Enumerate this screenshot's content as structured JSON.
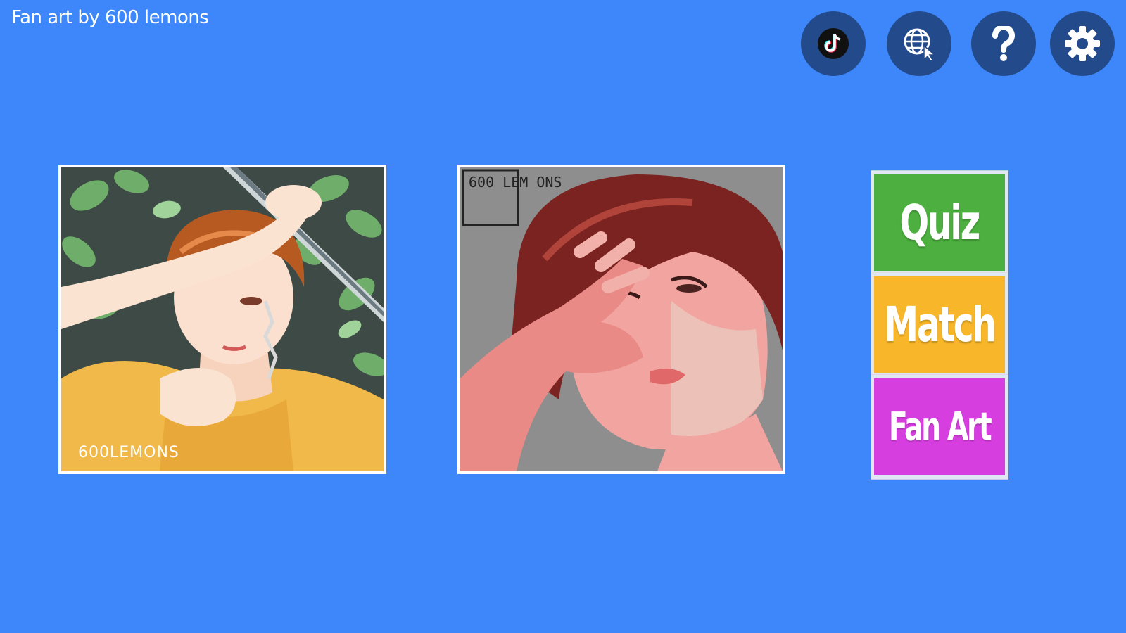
{
  "header": {
    "credit": "Fan art by 600 lemons"
  },
  "toolbar": {
    "buttons": [
      {
        "name": "tiktok-button",
        "icon": "tiktok-icon"
      },
      {
        "name": "website-button",
        "icon": "globe-cursor-icon"
      },
      {
        "name": "help-button",
        "icon": "question-icon"
      },
      {
        "name": "settings-button",
        "icon": "gear-icon"
      }
    ]
  },
  "gallery": {
    "art1": {
      "watermark": "600LEMONS"
    },
    "art2": {
      "watermark": "600 LEM ONS"
    }
  },
  "menu": {
    "quiz_label": "Quiz",
    "match_label": "Match",
    "fanart_label": "Fan Art"
  },
  "colors": {
    "background": "#3d87fb",
    "icon_button": "#234a8a",
    "quiz": "#4caf3f",
    "match": "#f8b62a",
    "fanart": "#d73ee0"
  }
}
